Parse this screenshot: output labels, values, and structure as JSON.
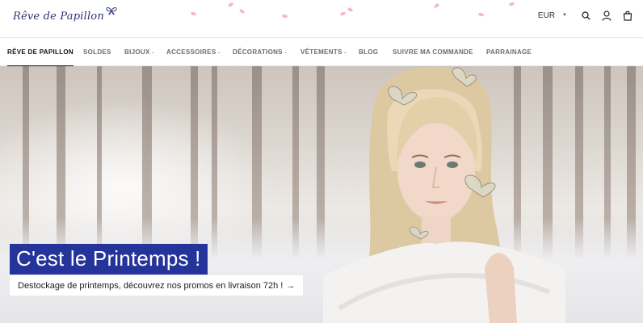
{
  "brand": {
    "logo_text": "Rêve de Papillon"
  },
  "header": {
    "currency": "EUR"
  },
  "nav": {
    "items": [
      {
        "label": "RÊVE DE PAPILLON",
        "has_dropdown": false,
        "active": true
      },
      {
        "label": "SOLDES",
        "has_dropdown": false,
        "active": false
      },
      {
        "label": "BIJOUX",
        "has_dropdown": true,
        "active": false
      },
      {
        "label": "ACCESSOIRES",
        "has_dropdown": true,
        "active": false
      },
      {
        "label": "DÉCORATIONS",
        "has_dropdown": true,
        "active": false
      },
      {
        "label": "VÊTEMENTS",
        "has_dropdown": true,
        "active": false
      },
      {
        "label": "BLOG",
        "has_dropdown": false,
        "active": false
      },
      {
        "label": "SUIVRE MA COMMANDE",
        "has_dropdown": false,
        "active": false
      },
      {
        "label": "PARRAINAGE",
        "has_dropdown": false,
        "active": false
      }
    ]
  },
  "hero": {
    "heading": "C'est le Printemps !",
    "cta_text": "Destockage de printemps, découvrez nos promos en livraison 72h !",
    "cta_arrow": "→"
  },
  "icons": [
    "butterfly-icon",
    "search-icon",
    "account-icon",
    "cart-icon",
    "chevron-down-icon",
    "arrow-right-icon"
  ],
  "colors": {
    "heading_bg": "#25349a",
    "logo": "#2c3575",
    "petals": "#f4b8c6"
  }
}
